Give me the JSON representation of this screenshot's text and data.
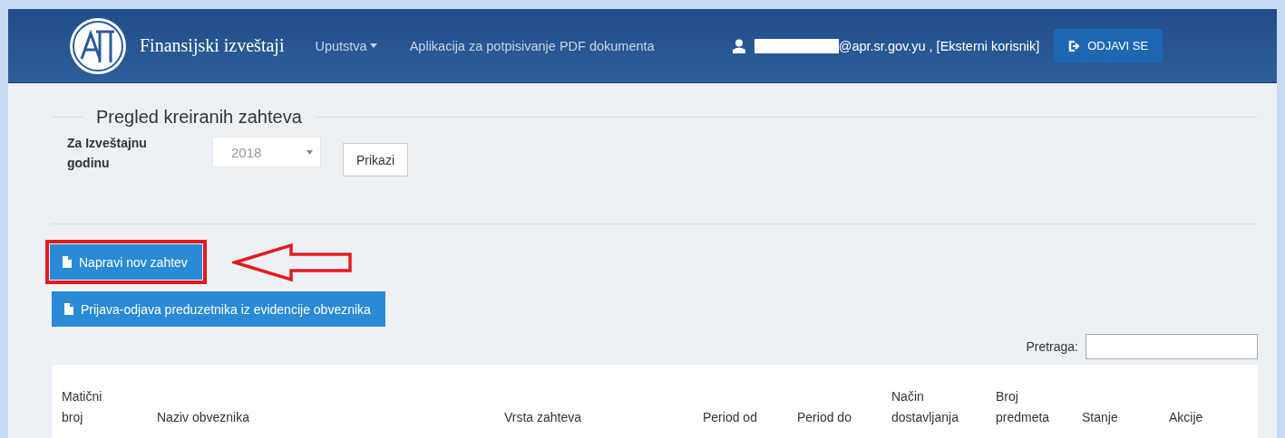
{
  "navbar": {
    "brand": "Finansijski izveštaji",
    "menu": [
      {
        "label": "Uputstva",
        "dropdown": true
      },
      {
        "label": "Aplikacija za potpisivanje PDF dokumenta",
        "dropdown": false
      }
    ],
    "user": "@apr.sr.gov.yu , [Eksterni korisnik]",
    "logout": "ODJAVI SE"
  },
  "section": {
    "title": "Pregled kreiranih zahteva",
    "year_label": "Za Izveštajnu godinu",
    "year_value": "2018",
    "show_button": "Prikazi"
  },
  "actions": [
    {
      "label": "Napravi nov zahtev",
      "highlighted": true
    },
    {
      "label": "Prijava-odjava preduzetnika iz evidencije obveznika",
      "highlighted": false
    }
  ],
  "search": {
    "label": "Pretraga:"
  },
  "table": {
    "columns": [
      "Matični broj",
      "Naziv obveznika",
      "Vrsta zahteva",
      "Period od",
      "Period do",
      "Način dostavljanja",
      "Broj predmeta",
      "Stanje",
      "Akcije"
    ]
  }
}
